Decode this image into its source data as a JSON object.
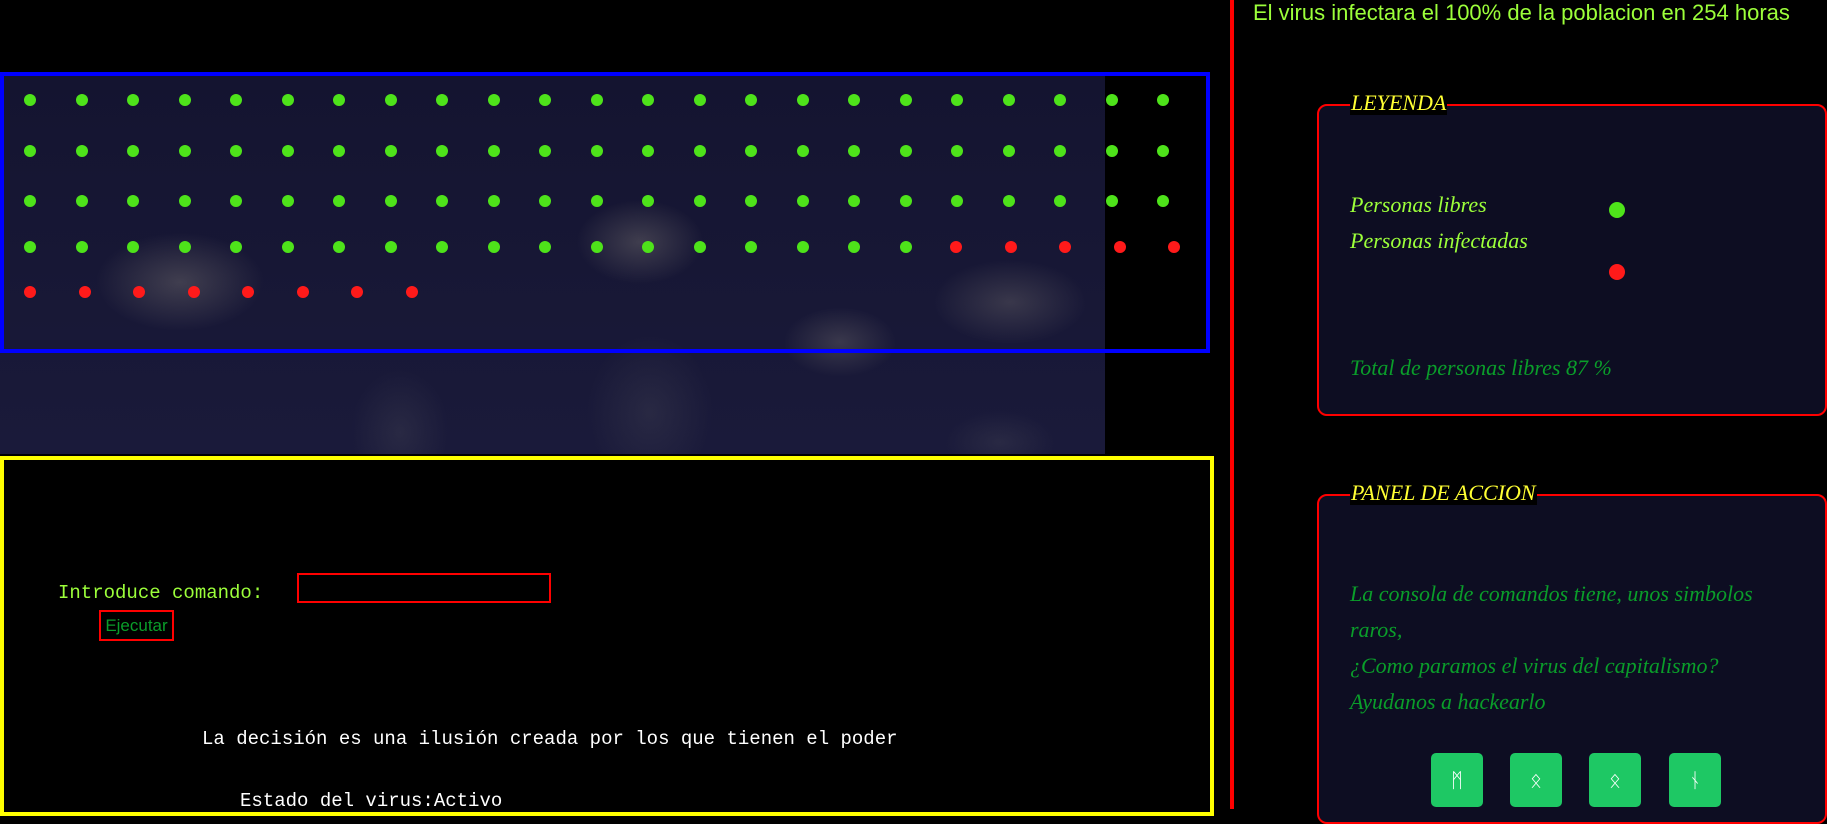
{
  "header": {
    "headline": "El virus infectara el 100% de la poblacion en 254 horas"
  },
  "map": {
    "free_color": "#4ee31a",
    "infected_color": "#ff1a1a",
    "rows": [
      {
        "status": [
          "free",
          "free",
          "free",
          "free",
          "free",
          "free",
          "free",
          "free",
          "free",
          "free",
          "free",
          "free",
          "free",
          "free",
          "free",
          "free",
          "free",
          "free",
          "free",
          "free",
          "free",
          "free",
          "free"
        ]
      },
      {
        "status": [
          "free",
          "free",
          "free",
          "free",
          "free",
          "free",
          "free",
          "free",
          "free",
          "free",
          "free",
          "free",
          "free",
          "free",
          "free",
          "free",
          "free",
          "free",
          "free",
          "free",
          "free",
          "free",
          "free"
        ]
      },
      {
        "status": [
          "free",
          "free",
          "free",
          "free",
          "free",
          "free",
          "free",
          "free",
          "free",
          "free",
          "free",
          "free",
          "free",
          "free",
          "free",
          "free",
          "free",
          "free",
          "free",
          "free",
          "free",
          "free",
          "free"
        ]
      },
      {
        "status": [
          "free",
          "free",
          "free",
          "free",
          "free",
          "free",
          "free",
          "free",
          "free",
          "free",
          "free",
          "free",
          "free",
          "free",
          "free",
          "free",
          "free",
          "free",
          "infected",
          "infected",
          "infected",
          "infected",
          "infected"
        ]
      },
      {
        "status": [
          "infected",
          "infected",
          "infected",
          "infected",
          "infected",
          "infected",
          "infected",
          "infected"
        ]
      }
    ]
  },
  "console": {
    "command_label": "Introduce comando:",
    "command_value": "",
    "execute_label": "Ejecutar",
    "quote": "La decisión es una ilusión creada por los que tienen el poder",
    "status_label": "Estado del virus:",
    "status_value": "Activo"
  },
  "legend": {
    "title": "LEYENDA",
    "free_label": "Personas libres",
    "infected_label": "Personas infectadas",
    "total_label": "Total de personas libres 87 %"
  },
  "action_panel": {
    "title": "PANEL DE ACCION",
    "lines": [
      "La consola de comandos tiene, unos simbolos raros,",
      "¿Como paramos el virus del capitalismo?",
      "Ayudanos a hackearlo"
    ],
    "buttons": [
      {
        "symbol": "ᛗ",
        "icon": "rune-mannaz-icon"
      },
      {
        "symbol": "ᛟ",
        "icon": "rune-othala-icon"
      },
      {
        "symbol": "ᛟ",
        "icon": "rune-othala-icon"
      },
      {
        "symbol": "ᚾ",
        "icon": "rune-naudiz-icon"
      }
    ]
  },
  "colors": {
    "map_frame": "#0000ff",
    "console_frame": "#ffff00",
    "divider": "#ff0000",
    "panel_border": "#ff0000",
    "panel_title": "#ffff33",
    "text_green": "#9cff3a",
    "text_dark_green": "#0a9d2a",
    "button_green": "#1ec864"
  }
}
